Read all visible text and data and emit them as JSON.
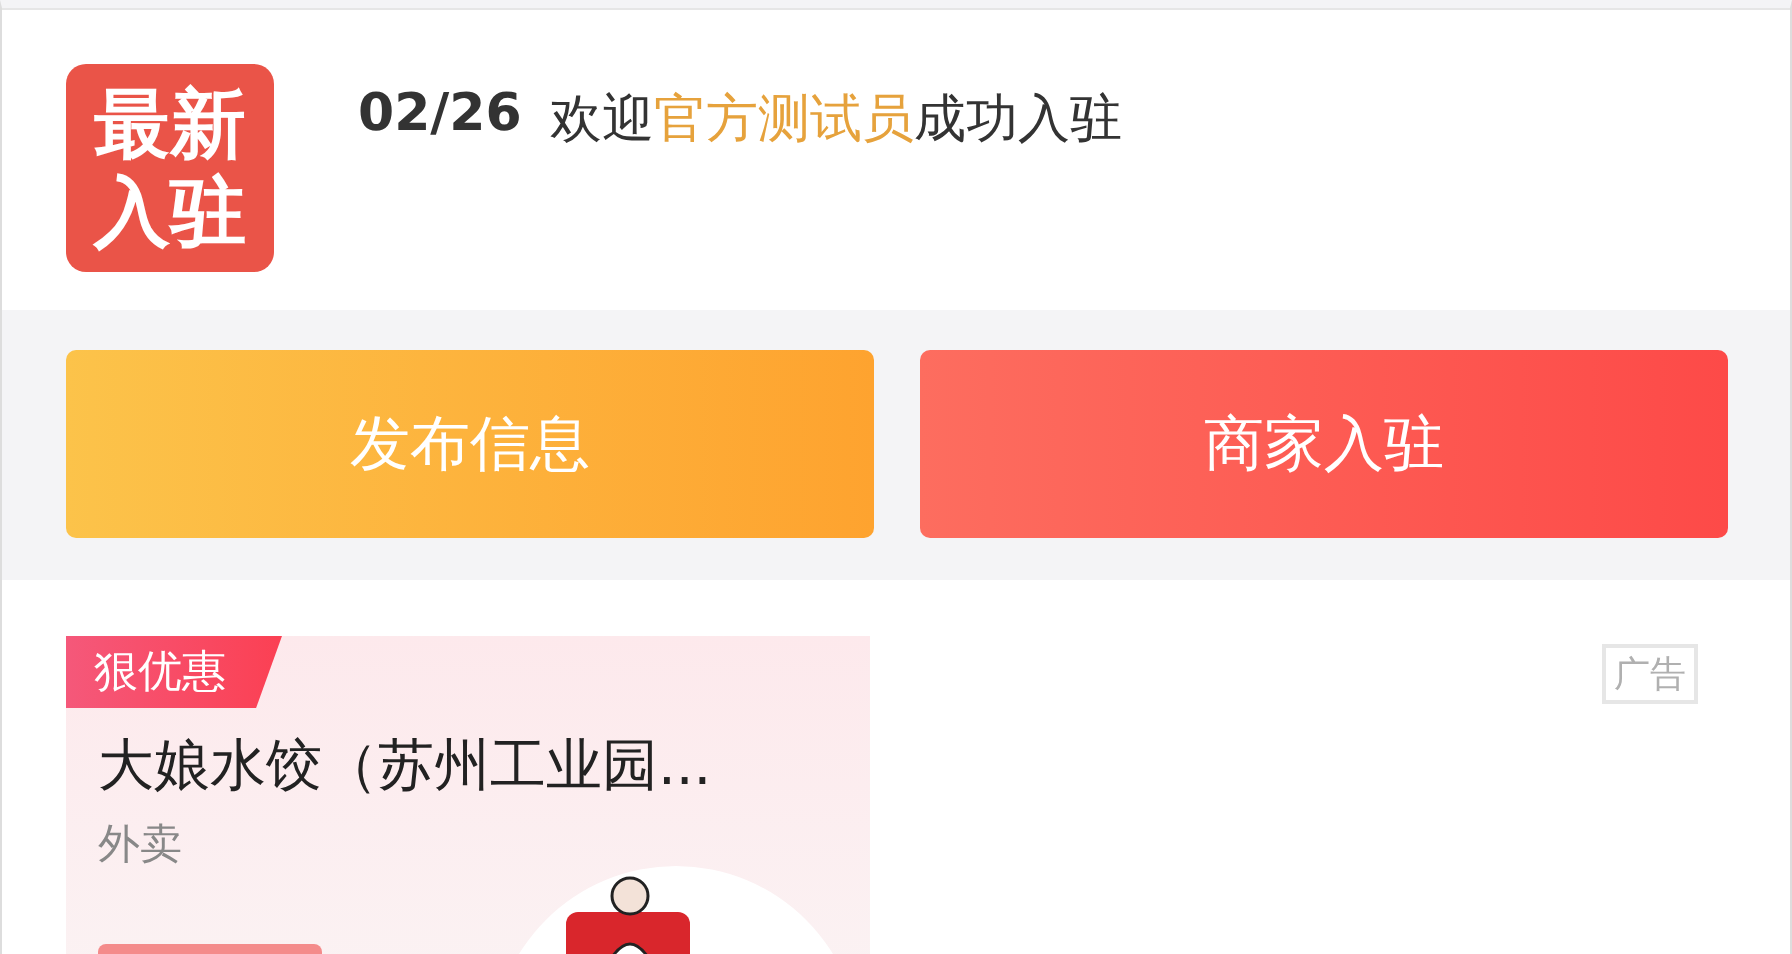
{
  "notice": {
    "badge_lines": [
      "最新",
      "入驻"
    ],
    "date": "02/26",
    "message": "欢迎**官方测试员**成功入驻"
  },
  "actions": [
    {
      "label": "发布信息",
      "kind": "orange"
    },
    {
      "label": "商家入驻",
      "kind": "red"
    }
  ],
  "promo": {
    "tag": "狠优惠",
    "title": "大娘水饺（苏州工业园...",
    "subtitle": "外卖",
    "ad_label": "广告"
  }
}
